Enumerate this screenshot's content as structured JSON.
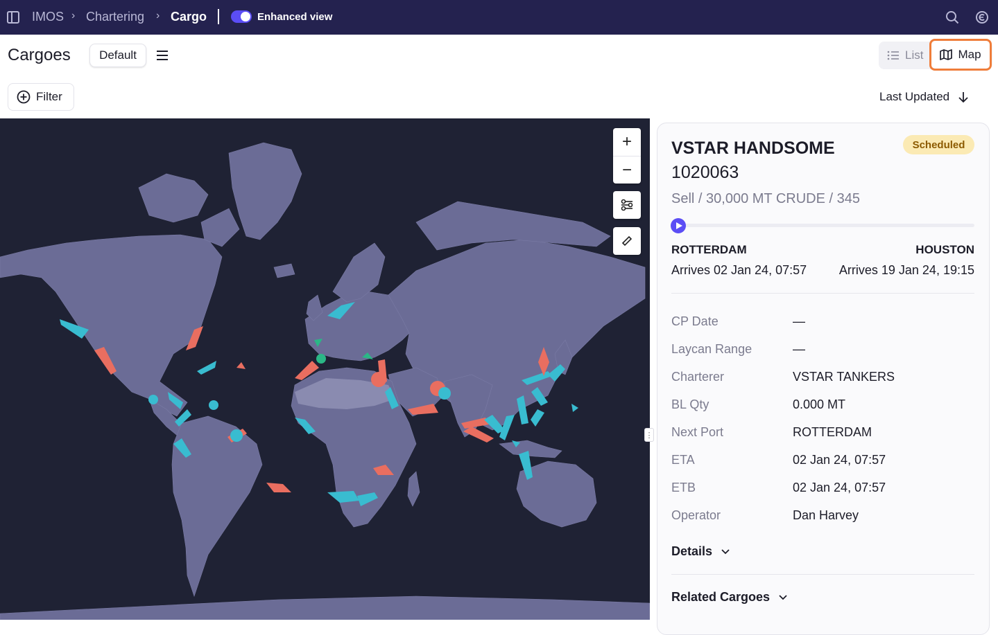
{
  "topbar": {
    "breadcrumb": [
      "IMOS",
      "Chartering",
      "Cargo"
    ],
    "enhanced_view_label": "Enhanced view",
    "enhanced_view_on": true
  },
  "header": {
    "title": "Cargoes",
    "view_name": "Default",
    "list_label": "List",
    "map_label": "Map",
    "active_view": "Map"
  },
  "toolbar": {
    "filter_label": "Filter",
    "sort_label": "Last Updated"
  },
  "map": {
    "zoom_in": "+",
    "zoom_out": "−"
  },
  "detail": {
    "vessel": "VSTAR HANDSOME",
    "voyage_no": "1020063",
    "status": "Scheduled",
    "summary": "Sell / 30,000 MT CRUDE / 345",
    "from_port": "ROTTERDAM",
    "to_port": "HOUSTON",
    "from_eta": "Arrives 02 Jan 24, 07:57",
    "to_eta": "Arrives 19 Jan 24, 19:15",
    "fields": [
      {
        "label": "CP Date",
        "value": "—"
      },
      {
        "label": "Laycan Range",
        "value": "—"
      },
      {
        "label": "Charterer",
        "value": "VSTAR TANKERS"
      },
      {
        "label": "BL Qty",
        "value": "0.000 MT"
      },
      {
        "label": "Next Port",
        "value": "ROTTERDAM"
      },
      {
        "label": "ETA",
        "value": "02 Jan 24, 07:57"
      },
      {
        "label": "ETB",
        "value": "02 Jan 24, 07:57"
      },
      {
        "label": "Operator",
        "value": "Dan Harvey"
      }
    ],
    "details_label": "Details",
    "related_label": "Related Cargoes"
  },
  "colors": {
    "topbar_bg": "#24224f",
    "accent": "#5b4df5",
    "map_highlight": "#ef7d3a",
    "map_sea": "#1f2234",
    "map_land": "#6b6c96",
    "vessel_cyan": "#39bcd0",
    "vessel_red": "#e96e60",
    "vessel_green": "#2bb786"
  }
}
